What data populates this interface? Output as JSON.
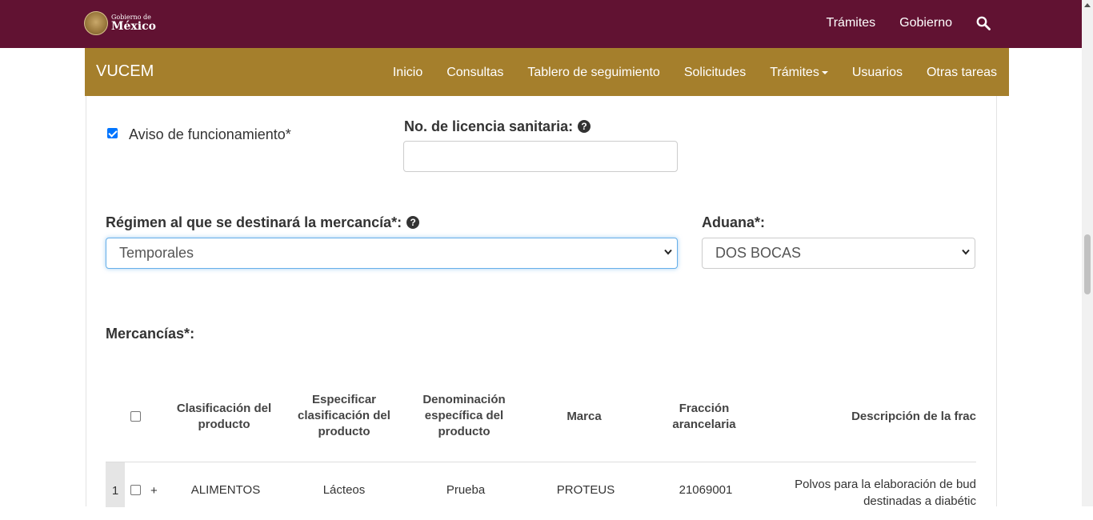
{
  "header": {
    "logo_small": "Gobierno de",
    "logo_big": "México",
    "links": [
      "Trámites",
      "Gobierno"
    ]
  },
  "navbar": {
    "brand": "VUCEM",
    "items": [
      "Inicio",
      "Consultas",
      "Tablero de seguimiento",
      "Solicitudes",
      "Trámites",
      "Usuarios",
      "Otras tareas"
    ]
  },
  "form": {
    "aviso_label": "Aviso de funcionamiento*",
    "aviso_checked": true,
    "licencia_label": "No. de licencia sanitaria:",
    "licencia_value": "",
    "regimen_label": "Régimen al que se destinará la mercancía*:",
    "regimen_value": "Temporales",
    "aduana_label": "Aduana*:",
    "aduana_value": "DOS BOCAS",
    "mercancias_label": "Mercancías*:"
  },
  "table": {
    "headers": {
      "clasificacion": "Clasificación del producto",
      "especificar": "Especificar clasificación del producto",
      "denominacion": "Denominación específica del producto",
      "marca": "Marca",
      "fraccion": "Fracción arancelaria",
      "descripcion": "Descripción de la frac"
    },
    "row": {
      "num": "1",
      "expand": "+",
      "clasificacion": "ALIMENTOS",
      "especificar": "Lácteos",
      "denominacion": "Prueba",
      "marca": "PROTEUS",
      "fraccion": "21069001",
      "descripcion_line1": "Polvos para la elaboración de bud",
      "descripcion_line2": "destinadas a diabétic"
    }
  },
  "icons": {
    "search": "search-icon",
    "help": "question-circle-icon",
    "select_arrow": "chevron-down-icon"
  },
  "colors": {
    "topbar": "#611232",
    "navbar": "#a57f2c",
    "checkbox": "#0075ff"
  }
}
